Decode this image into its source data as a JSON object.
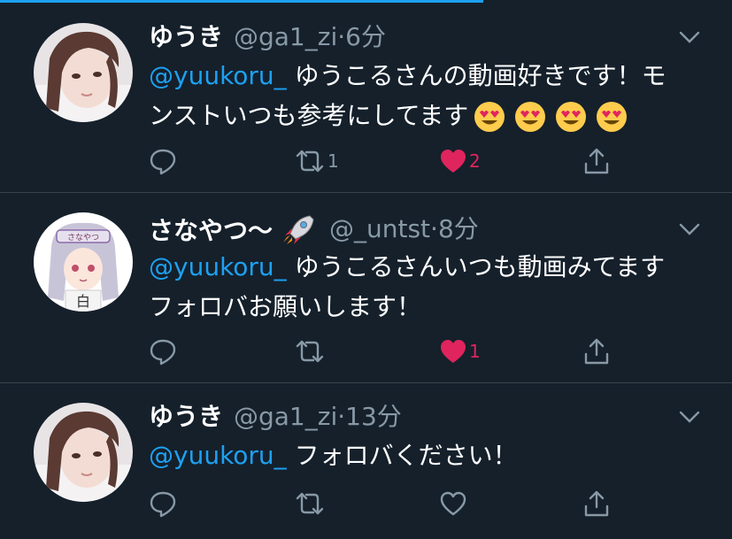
{
  "progress": 0.66,
  "colors": {
    "bg": "#15202b",
    "text": "#ffffff",
    "muted": "#8899a6",
    "link": "#1da1f2",
    "like": "#e0245e",
    "divider": "#38444d"
  },
  "tweets": [
    {
      "name": "ゆうき",
      "handle": "@ga1_zi",
      "dot": "·",
      "time": "6分",
      "mention": "@yuukoru_",
      "text_line1": "ゆうこるさんの動画好きです！モ",
      "text_line2": "ンストいつも参考にしてます",
      "emojis": [
        "heart-eyes-emoji",
        "heart-eyes-emoji",
        "heart-eyes-emoji",
        "heart-eyes-emoji"
      ],
      "reply_count": "",
      "retweet_count": "1",
      "like_count": "2",
      "liked": true
    },
    {
      "name": "さなやつ〜",
      "name_emoji": "rocket-emoji",
      "handle": "@_untst",
      "dot": "·",
      "time": "8分",
      "mention": "@yuukoru_",
      "text_line1": "ゆうこるさんいつも動画みてます",
      "text_line2": "フォロバお願いします！",
      "reply_count": "",
      "retweet_count": "",
      "like_count": "1",
      "liked": true
    },
    {
      "name": "ゆうき",
      "handle": "@ga1_zi",
      "dot": "·",
      "time": "13分",
      "mention": "@yuukoru_",
      "text_line1": "フォロバください！",
      "reply_count": "",
      "retweet_count": "",
      "like_count": "",
      "liked": false
    }
  ]
}
